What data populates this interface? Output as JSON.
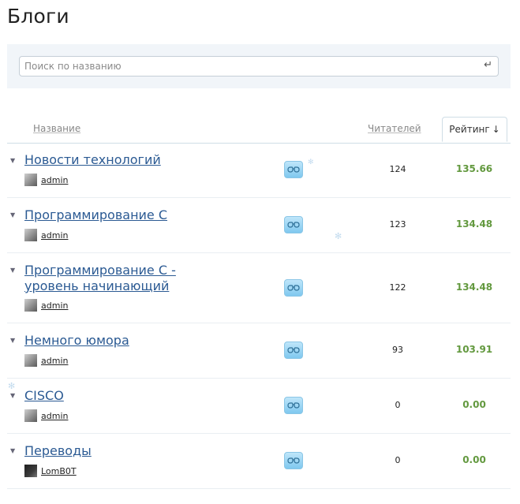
{
  "page": {
    "title": "Блоги"
  },
  "search": {
    "placeholder": "Поиск по названию",
    "enter_glyph": "↵"
  },
  "table": {
    "headers": {
      "name": "Название",
      "readers": "Читателей",
      "rating": "Рейтинг",
      "rating_sort_glyph": "↓"
    },
    "row_toggle_glyph": "▼",
    "rows": [
      {
        "name": "Новости технологий",
        "author": "admin",
        "readers": "124",
        "rating": "135.66"
      },
      {
        "name": "Программирование C",
        "author": "admin",
        "readers": "123",
        "rating": "134.48"
      },
      {
        "name": "Программирование C - уровень начинающий",
        "author": "admin",
        "readers": "122",
        "rating": "134.48"
      },
      {
        "name": "Немного юмора",
        "author": "admin",
        "readers": "93",
        "rating": "103.91"
      },
      {
        "name": "CISCO",
        "author": "admin",
        "readers": "0",
        "rating": "0.00"
      },
      {
        "name": "Переводы",
        "author": "LomB0T",
        "readers": "0",
        "rating": "0.00"
      }
    ]
  },
  "icons": {
    "read": "glasses-icon",
    "toggle": "chevron-down-icon",
    "enter": "enter-icon"
  },
  "colors": {
    "link": "#2b5a93",
    "rating": "#63993f",
    "panel": "#f1f5f9"
  }
}
